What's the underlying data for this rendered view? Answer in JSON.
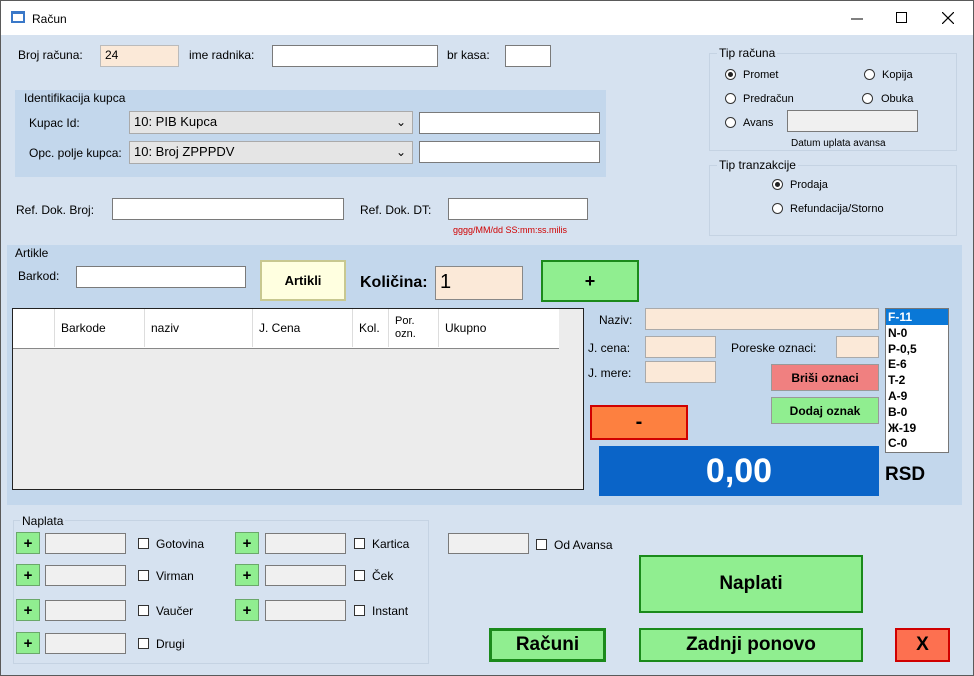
{
  "window": {
    "title": "Račun"
  },
  "header": {
    "broj_label": "Broj računa:",
    "broj_value": "24",
    "radnik_label": "ime radnika:",
    "radnik_value": "",
    "kasa_label": "br kasa:",
    "kasa_value": ""
  },
  "kupac": {
    "group_label": "Identifikacija kupca",
    "id_label": "Kupac Id:",
    "id_select": "10: PIB Kupca",
    "id_value": "",
    "opc_label": "Opc. polje kupca:",
    "opc_select": "10: Broj ZPPPDV",
    "opc_value": ""
  },
  "ref": {
    "broj_label": "Ref. Dok. Broj:",
    "broj_value": "",
    "dt_label": "Ref. Dok. DT:",
    "dt_value": "",
    "dt_hint": "gggg/MM/dd SS:mm:ss.milis"
  },
  "tip_racuna": {
    "label": "Tip računa",
    "options": [
      "Promet",
      "Kopija",
      "Predračun",
      "Obuka",
      "Avans"
    ],
    "selected": "Promet",
    "avans_value": "",
    "avans_hint": "Datum uplata avansa"
  },
  "tip_tranzakcije": {
    "label": "Tip tranzakcije",
    "options": [
      "Prodaja",
      "Refundacija/Storno"
    ],
    "selected": "Prodaja"
  },
  "artikle": {
    "group_label": "Artikle",
    "barkod_label": "Barkod:",
    "barkod_value": "",
    "artikli_button": "Artikli",
    "kolicina_label": "Količina:",
    "kolicina_value": "1",
    "plus_button": "+",
    "minus_button": "-",
    "table_columns": [
      "",
      "Barkode",
      "naziv",
      "J. Cena",
      "Kol.",
      "Por. ozn.",
      "Ukupno"
    ],
    "table_rows": []
  },
  "detail": {
    "naziv_label": "Naziv:",
    "naziv_value": "",
    "jcena_label": "J. cena:",
    "jcena_value": "",
    "jmere_label": "J. mere:",
    "jmere_value": "",
    "poreske_label": "Poreske oznaci:",
    "poreske_value": "",
    "brisi_button": "Briši oznaci",
    "dodaj_button": "Dodaj oznak",
    "total": "0,00",
    "currency": "RSD",
    "tax_list": [
      "F-11",
      "N-0",
      "P-0,5",
      "E-6",
      "T-2",
      "A-9",
      "B-0",
      "Ж-19",
      "C-0"
    ],
    "tax_selected": "F-11"
  },
  "naplata": {
    "group_label": "Naplata",
    "plus": "+",
    "left": [
      {
        "label": "Gotovina",
        "value": ""
      },
      {
        "label": "Virman",
        "value": ""
      },
      {
        "label": "Vaučer",
        "value": ""
      },
      {
        "label": "Drugi",
        "value": ""
      }
    ],
    "right": [
      {
        "label": "Kartica",
        "value": ""
      },
      {
        "label": "Ček",
        "value": ""
      },
      {
        "label": "Instant",
        "value": ""
      }
    ],
    "od_avansa_value": "",
    "od_avansa_label": "Od Avansa"
  },
  "actions": {
    "naplati": "Naplati",
    "racuni": "Računi",
    "zadnji": "Zadnji ponovo",
    "close": "X"
  }
}
